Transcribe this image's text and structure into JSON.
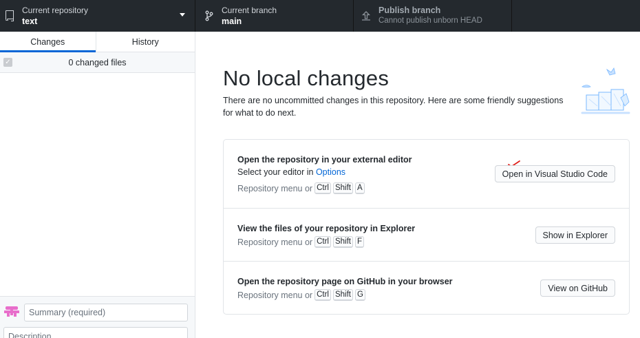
{
  "toolbar": {
    "repo_label": "Current repository",
    "repo_value": "text",
    "branch_label": "Current branch",
    "branch_value": "main",
    "publish_label": "Publish branch",
    "publish_sub": "Cannot publish unborn HEAD"
  },
  "sidebar": {
    "tabs": [
      "Changes",
      "History"
    ],
    "active_tab": "Changes",
    "changed_files": "0 changed files",
    "summary_placeholder": "Summary (required)",
    "description_placeholder": "Description"
  },
  "main": {
    "title": "No local changes",
    "subtitle": "There are no uncommitted changes in this repository. Here are some friendly suggestions for what to do next.",
    "suggestions": [
      {
        "title": "Open the repository in your external editor",
        "line_prefix": "Select your editor in ",
        "line_link": "Options",
        "shortcut_prefix": "Repository menu or",
        "keys": [
          "Ctrl",
          "Shift",
          "A"
        ],
        "button": "Open in Visual Studio Code"
      },
      {
        "title": "View the files of your repository in Explorer",
        "shortcut_prefix": "Repository menu or",
        "keys": [
          "Ctrl",
          "Shift",
          "F"
        ],
        "button": "Show in Explorer"
      },
      {
        "title": "Open the repository page on GitHub in your browser",
        "shortcut_prefix": "Repository menu or",
        "keys": [
          "Ctrl",
          "Shift",
          "G"
        ],
        "button": "View on GitHub"
      }
    ]
  },
  "icons": {
    "repo": "repo-icon",
    "branch": "git-branch-icon",
    "publish": "upload-icon",
    "caret": "caret-down-icon",
    "avatar": "avatar-icon",
    "check": "checkbox-icon"
  },
  "colors": {
    "toolbar_bg": "#24292e",
    "accent": "#0366d6",
    "annotation_red": "#e0201b"
  }
}
